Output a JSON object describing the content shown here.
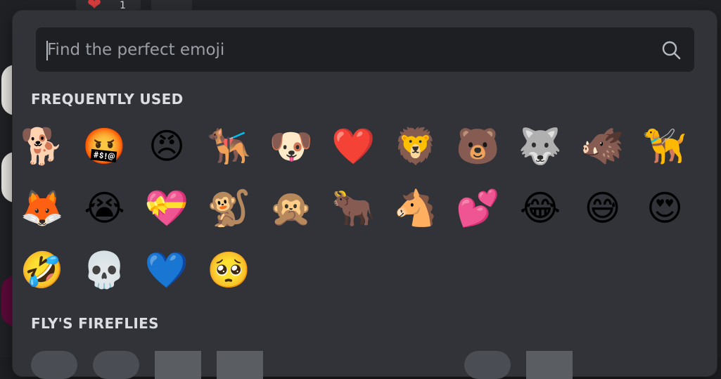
{
  "search": {
    "placeholder": "Find the perfect emoji"
  },
  "sections": {
    "frequent_title": "FREQUENTLY USED",
    "fireflies_title": "FLY'S FIREFLIES"
  },
  "background": {
    "heart_reaction": "❤",
    "heart_count": "1"
  },
  "frequently_used": [
    {
      "name": "dog",
      "char": "🐕"
    },
    {
      "name": "face-with-symbols-on-mouth",
      "char": "🤬"
    },
    {
      "name": "angry-face",
      "char": "😠"
    },
    {
      "name": "service-dog",
      "char": "🐕‍🦺"
    },
    {
      "name": "dog-face",
      "char": "🐶"
    },
    {
      "name": "red-heart",
      "char": "❤️"
    },
    {
      "name": "lion",
      "char": "🦁"
    },
    {
      "name": "bear",
      "char": "🐻"
    },
    {
      "name": "wolf",
      "char": "🐺"
    },
    {
      "name": "boar",
      "char": "🐗"
    },
    {
      "name": "guide-dog",
      "char": "🦮"
    },
    {
      "name": "fox",
      "char": "🦊"
    },
    {
      "name": "loudly-crying-face",
      "char": "😭"
    },
    {
      "name": "custom-angel-heart",
      "char": "💝"
    },
    {
      "name": "monkey",
      "char": "🐒"
    },
    {
      "name": "speak-no-evil-monkey",
      "char": "🙊"
    },
    {
      "name": "ox",
      "char": "🐂"
    },
    {
      "name": "horse-face",
      "char": "🐴"
    },
    {
      "name": "two-hearts",
      "char": "💕"
    },
    {
      "name": "face-with-tears-of-joy",
      "char": "😂"
    },
    {
      "name": "grinning-face-with-sweat",
      "char": "😅"
    },
    {
      "name": "smiling-face-with-heart-eyes",
      "char": "😍"
    },
    {
      "name": "rolling-on-the-floor-laughing",
      "char": "🤣"
    },
    {
      "name": "skull",
      "char": "💀"
    },
    {
      "name": "blue-heart",
      "char": "💙"
    },
    {
      "name": "pleading-face",
      "char": "🥺"
    }
  ]
}
